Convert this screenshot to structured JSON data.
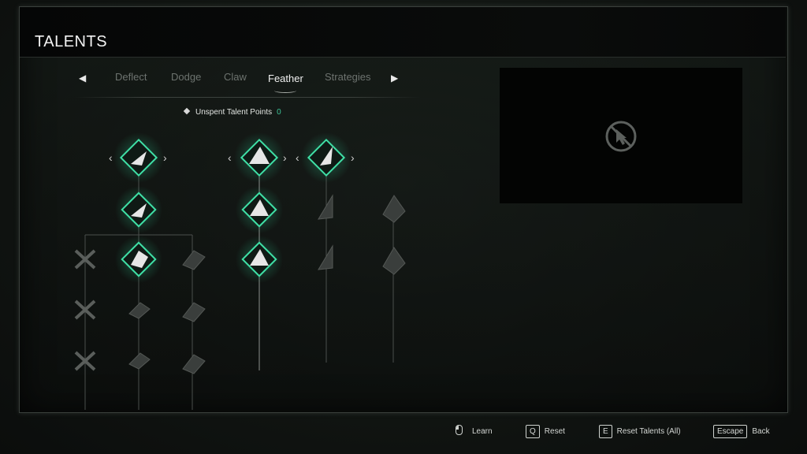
{
  "header": {
    "title": "TALENTS"
  },
  "tabs": {
    "items": [
      "Deflect",
      "Dodge",
      "Claw",
      "Feather",
      "Strategies"
    ],
    "active": "Feather",
    "prev_icon": "chevron-left-icon",
    "next_icon": "chevron-right-icon"
  },
  "points": {
    "label": "Unspent Talent Points",
    "value": "0"
  },
  "preview": {
    "icon": "no-cursor-icon"
  },
  "talents": {
    "columns": [
      {
        "nodes": [
          "locked",
          "locked",
          "locked"
        ]
      },
      {
        "nodes": [
          "active",
          "active",
          "active",
          "locked",
          "locked"
        ]
      },
      {
        "nodes": [
          "locked",
          "locked",
          "locked"
        ]
      },
      {
        "nodes": [
          "active",
          "active",
          "active"
        ]
      },
      {
        "nodes": [
          "active",
          "locked",
          "locked"
        ]
      },
      {
        "nodes": [
          "locked",
          "locked"
        ]
      }
    ],
    "accent_color": "#2fd39a"
  },
  "footer": {
    "learn": "Learn",
    "reset_key": "Q",
    "reset": "Reset",
    "reset_all_key": "E",
    "reset_all": "Reset Talents (All)",
    "back_key": "Escape",
    "back": "Back"
  }
}
